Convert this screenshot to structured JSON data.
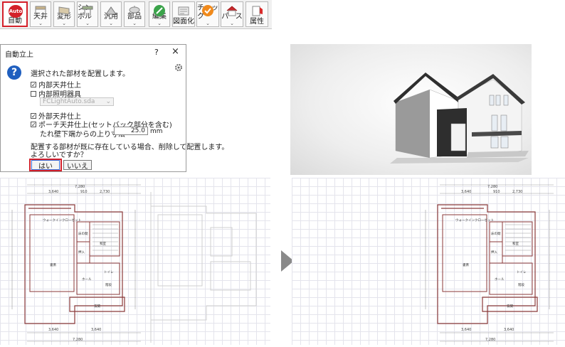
{
  "toolbar": {
    "buttons": [
      {
        "id": "auto",
        "label": "自動",
        "badge": "Auto"
      },
      {
        "id": "ceiling",
        "label": "天井"
      },
      {
        "id": "deform",
        "label": "変形"
      },
      {
        "id": "symbol",
        "label": "シンボル"
      },
      {
        "id": "general",
        "label": "汎用"
      },
      {
        "id": "parts",
        "label": "部品"
      },
      {
        "id": "edit",
        "label": "編集"
      },
      {
        "id": "drawing",
        "label": "図面化"
      },
      {
        "id": "check",
        "label": "チェック"
      },
      {
        "id": "perspective",
        "label": "パース"
      },
      {
        "id": "attribute",
        "label": "属性"
      }
    ]
  },
  "dialog": {
    "title": "自動立上",
    "help": "?",
    "close": "×",
    "message": "選択された部材を配置します。",
    "options": [
      {
        "label": "内部天井仕上",
        "checked": true
      },
      {
        "label": "内部照明器具",
        "checked": false
      },
      {
        "label": "外部天井仕上",
        "checked": true
      },
      {
        "label": "ポーチ天井仕上(セットバック部分を含む)",
        "checked": true
      }
    ],
    "lighting_file": "FCLightAuto.sda",
    "sag_label": "たれ壁下端からの上り寸法",
    "sag_value": "25.0",
    "sag_unit": "mm",
    "confirm_line1": "配置する部材が既に存在している場合、削除して配置します。",
    "confirm_line2": "よろしいですか？",
    "yes": "はい",
    "no": "いいえ"
  },
  "plan": {
    "dims_top": [
      "7,280",
      "3,640",
      "910",
      "2,730"
    ],
    "dims_bottom": [
      "3,640",
      "3,640",
      "7,280"
    ],
    "rooms": {
      "walk_in": "ウォークインクローゼット",
      "closet": "床の間",
      "washitsu": "和室",
      "oshiire": "押入",
      "main": "書斎",
      "toilet": "トイレ",
      "hall": "ホール",
      "stairs": "階段",
      "entrance": "玄関"
    }
  },
  "colors": {
    "accent": "#d4202a",
    "wall": "#8b3a3a"
  }
}
